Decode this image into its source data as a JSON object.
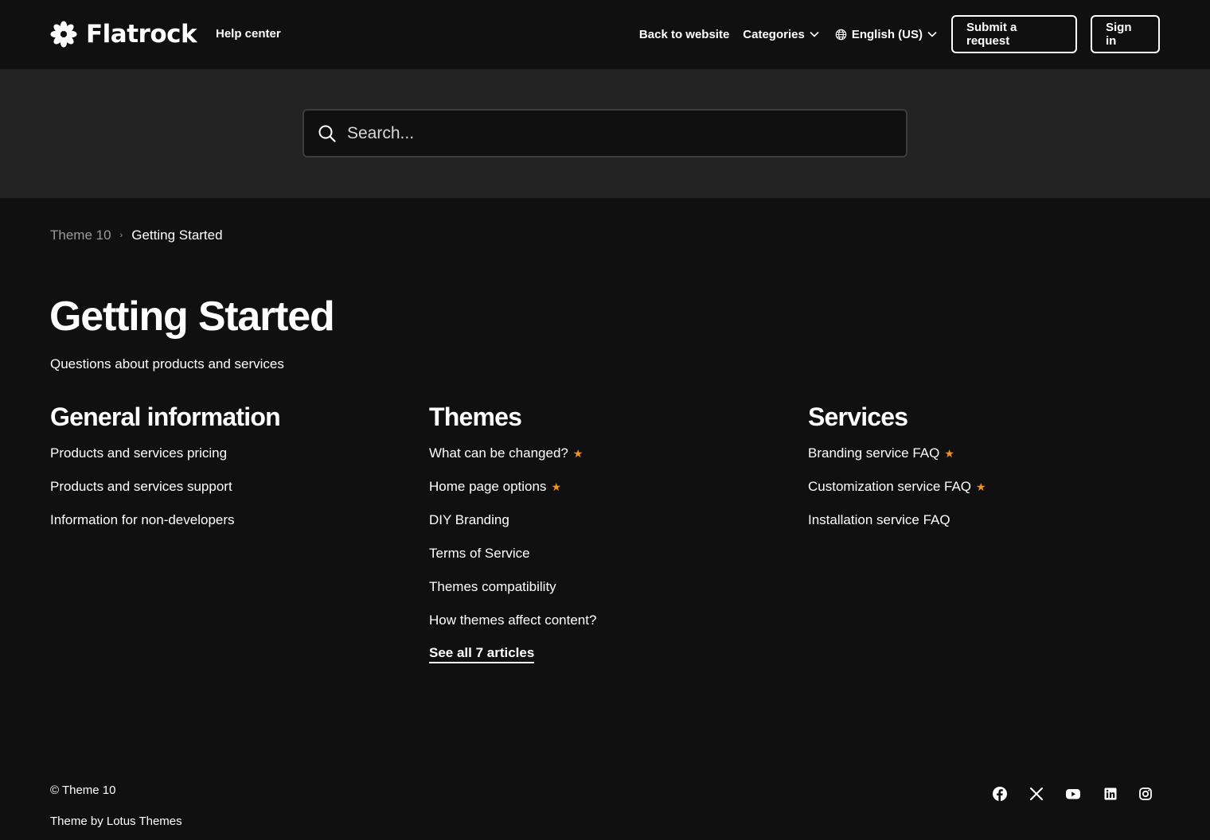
{
  "header": {
    "logo_text": "Flatrock",
    "help_center": "Help center",
    "nav": {
      "back": "Back to website",
      "categories": "Categories",
      "language": "English (US)"
    },
    "submit_request": "Submit a request",
    "sign_in": "Sign in"
  },
  "search": {
    "placeholder": "Search..."
  },
  "breadcrumb": [
    "Theme 10",
    "Getting Started"
  ],
  "page": {
    "title": "Getting Started",
    "description": "Questions about products and services"
  },
  "sections": [
    {
      "title": "General information",
      "articles": [
        {
          "title": "Products and services pricing",
          "promoted": false
        },
        {
          "title": "Products and services support",
          "promoted": false
        },
        {
          "title": "Information for non-developers",
          "promoted": false
        }
      ]
    },
    {
      "title": "Themes",
      "articles": [
        {
          "title": "What can be changed?",
          "promoted": true
        },
        {
          "title": "Home page options",
          "promoted": true
        },
        {
          "title": "DIY Branding",
          "promoted": false
        },
        {
          "title": "Terms of Service",
          "promoted": false
        },
        {
          "title": "Themes compatibility",
          "promoted": false
        },
        {
          "title": "How themes affect content?",
          "promoted": false
        }
      ],
      "see_all": "See all 7 articles"
    },
    {
      "title": "Services",
      "articles": [
        {
          "title": "Branding service FAQ",
          "promoted": true
        },
        {
          "title": "Customization service FAQ",
          "promoted": true
        },
        {
          "title": "Installation service FAQ",
          "promoted": false
        }
      ]
    }
  ],
  "footer": {
    "copyright": "© Theme 10",
    "theme_by": "Theme by Lotus Themes",
    "social": [
      "facebook-icon",
      "x-icon",
      "youtube-icon",
      "linkedin-icon",
      "instagram-icon"
    ]
  },
  "colors": {
    "background": "#101010",
    "search_band": "#232323",
    "accent_star": "#f0921c",
    "breadcrumb_muted": "#9a9a9a"
  }
}
